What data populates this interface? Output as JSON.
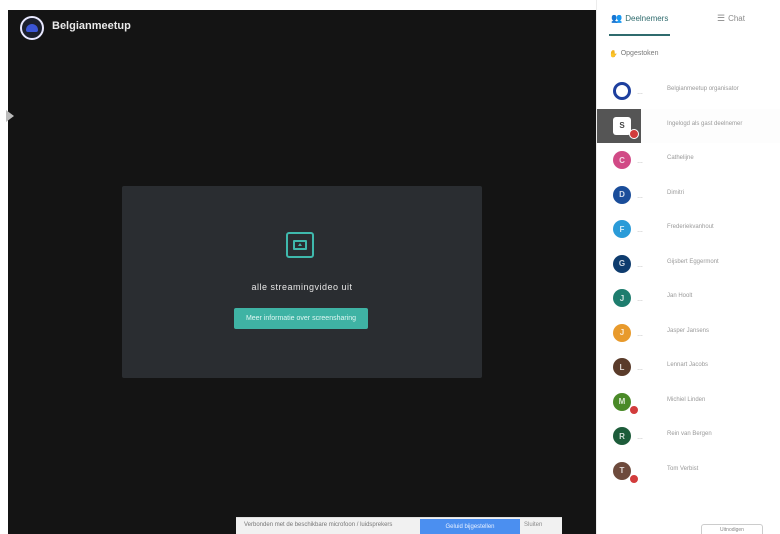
{
  "meeting": {
    "name": "Belgianmeetup",
    "logo_icon": "meeting-logo-icon"
  },
  "share_card": {
    "icon": "screen-share-icon",
    "message": "alle streamingvideo uit",
    "button_label": "Meer informatie over screensharing"
  },
  "notice": {
    "text": "Verbonden met de beschikbare microfoon / luidsprekers",
    "primary_label": "Geluid bijgestellen",
    "secondary_label": "Sluiten"
  },
  "panel": {
    "tabs": [
      {
        "label": "Deelnemers",
        "icon": "people-icon"
      },
      {
        "label": "Chat",
        "icon": "chat-icon"
      }
    ],
    "raised_hands_label": "Opgestoken"
  },
  "participants": [
    {
      "name": "Belgianmeetup organisator",
      "initial": "",
      "color": "#1d3f9e",
      "badge": false,
      "kind": "logo"
    },
    {
      "name": "Ingelogd als gast deelnemer",
      "initial": "S",
      "color": "#555555",
      "badge": true,
      "kind": "self"
    },
    {
      "name": "Cathelijne",
      "initial": "C",
      "color": "#d14a86",
      "badge": false,
      "kind": "initial"
    },
    {
      "name": "Dimitri",
      "initial": "D",
      "color": "#1a4d9a",
      "badge": false,
      "kind": "initial"
    },
    {
      "name": "Frederiekvanhout",
      "initial": "F",
      "color": "#2a9bd8",
      "badge": false,
      "kind": "initial"
    },
    {
      "name": "Gijsbert Eggermont",
      "initial": "G",
      "color": "#0e3c6e",
      "badge": false,
      "kind": "initial"
    },
    {
      "name": "Jan Hoolt",
      "initial": "J",
      "color": "#1e7d6e",
      "badge": false,
      "kind": "initial"
    },
    {
      "name": "Jasper Jansens",
      "initial": "J",
      "color": "#e89a2c",
      "badge": false,
      "kind": "initial"
    },
    {
      "name": "Lennart Jacobs",
      "initial": "L",
      "color": "#5a3b2a",
      "badge": false,
      "kind": "initial"
    },
    {
      "name": "Michiel Linden",
      "initial": "M",
      "color": "#4a8a28",
      "badge": true,
      "kind": "initial"
    },
    {
      "name": "Rein van Bergen",
      "initial": "R",
      "color": "#1d5c3a",
      "badge": false,
      "kind": "initial"
    },
    {
      "name": "Tom Verbist",
      "initial": "T",
      "color": "#6d4a3c",
      "badge": true,
      "kind": "initial"
    }
  ],
  "invite_label": "Uitnodigen"
}
